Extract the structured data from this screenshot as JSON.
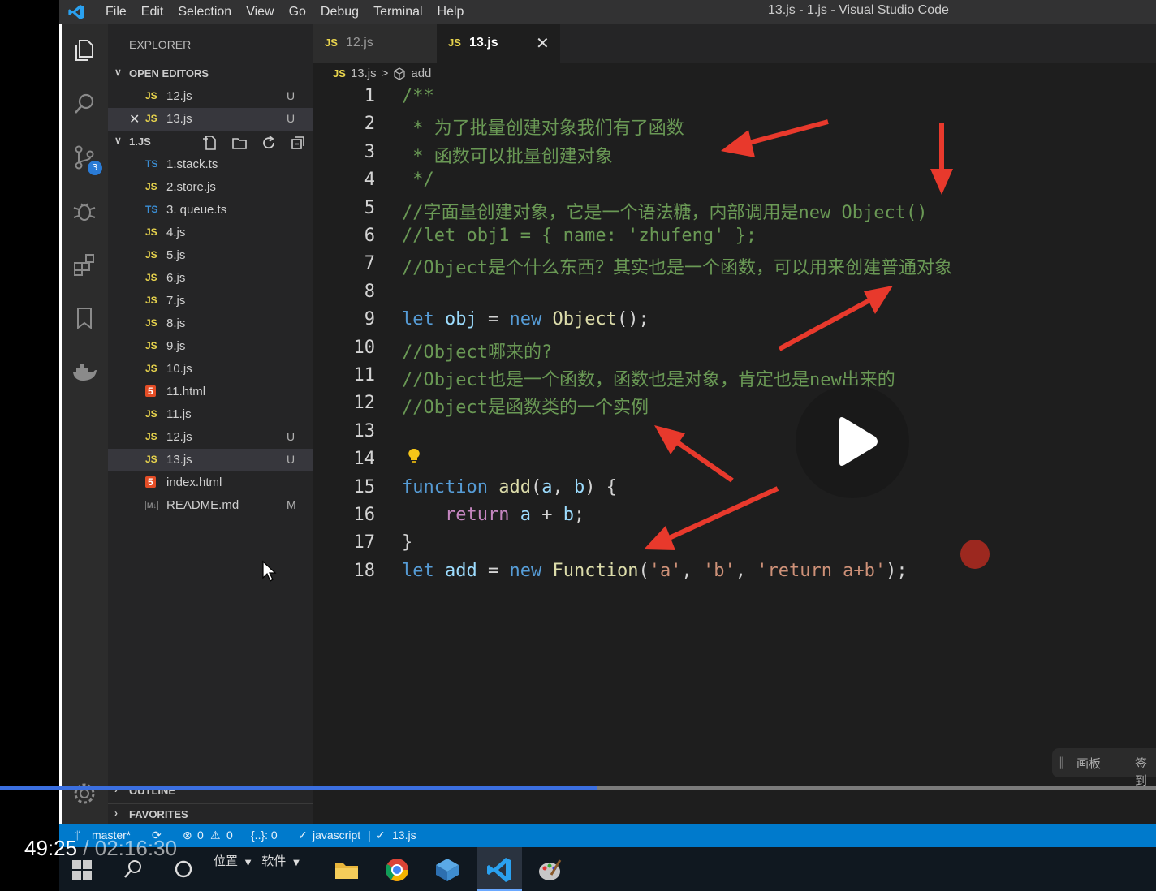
{
  "titlebar": {
    "menu": [
      "File",
      "Edit",
      "Selection",
      "View",
      "Go",
      "Debug",
      "Terminal",
      "Help"
    ],
    "window_title": "13.js - 1.js - Visual Studio Code"
  },
  "activity_bar": {
    "icons": [
      "files-icon",
      "search-icon",
      "source-control-icon",
      "debug-icon",
      "extensions-icon",
      "bookmark-icon",
      "docker-icon",
      "settings-gear-icon"
    ],
    "scm_badge": "3"
  },
  "sidebar": {
    "title": "EXPLORER",
    "open_editors": {
      "label": "OPEN EDITORS",
      "items": [
        {
          "icon": "JS",
          "name": "12.js",
          "status": "U"
        },
        {
          "icon": "JS",
          "name": "13.js",
          "status": "U"
        }
      ]
    },
    "folder": {
      "label": "1.JS",
      "files": [
        {
          "icon": "TS",
          "name": "1.stack.ts",
          "status": ""
        },
        {
          "icon": "JS",
          "name": "2.store.js",
          "status": ""
        },
        {
          "icon": "TS",
          "name": "3. queue.ts",
          "status": ""
        },
        {
          "icon": "JS",
          "name": "4.js",
          "status": ""
        },
        {
          "icon": "JS",
          "name": "5.js",
          "status": ""
        },
        {
          "icon": "JS",
          "name": "6.js",
          "status": ""
        },
        {
          "icon": "JS",
          "name": "7.js",
          "status": ""
        },
        {
          "icon": "JS",
          "name": "8.js",
          "status": ""
        },
        {
          "icon": "JS",
          "name": "9.js",
          "status": ""
        },
        {
          "icon": "JS",
          "name": "10.js",
          "status": ""
        },
        {
          "icon": "5",
          "name": "11.html",
          "status": ""
        },
        {
          "icon": "JS",
          "name": "11.js",
          "status": ""
        },
        {
          "icon": "JS",
          "name": "12.js",
          "status": "U"
        },
        {
          "icon": "JS",
          "name": "13.js",
          "status": "U"
        },
        {
          "icon": "5",
          "name": "index.html",
          "status": ""
        },
        {
          "icon": "M↓",
          "name": "README.md",
          "status": "M"
        }
      ]
    },
    "outline_label": "OUTLINE",
    "favorites_label": "FAVORITES"
  },
  "tabs": [
    {
      "icon": "JS",
      "name": "12.js"
    },
    {
      "icon": "JS",
      "name": "13.js",
      "close": "✕"
    }
  ],
  "breadcrumb": {
    "icon": "JS",
    "file": "13.js",
    "sep": ">",
    "symbol": "add"
  },
  "code_lines": [
    {
      "n": "1",
      "text": "/**"
    },
    {
      "n": "2",
      "text": " * 为了批量创建对象我们有了函数"
    },
    {
      "n": "3",
      "text": " * 函数可以批量创建对象"
    },
    {
      "n": "4",
      "text": " */"
    },
    {
      "n": "5",
      "text": "//字面量创建对象，它是一个语法糖，内部调用是new Object()"
    },
    {
      "n": "6",
      "text": "//let obj1 = { name: 'zhufeng' };"
    },
    {
      "n": "7",
      "text": "//Object是个什么东西？其实也是一个函数，可以用来创建普通对象"
    },
    {
      "n": "8",
      "text": ""
    },
    {
      "n": "9",
      "text": "let obj = new Object();"
    },
    {
      "n": "10",
      "text": "//Object哪来的?"
    },
    {
      "n": "11",
      "text": "//Object也是一个函数，函数也是对象，肯定也是new出来的"
    },
    {
      "n": "12",
      "text": "//Object是函数类的一个实例"
    },
    {
      "n": "13",
      "text": ""
    },
    {
      "n": "14",
      "text": ""
    },
    {
      "n": "15",
      "text": "function add(a, b) {"
    },
    {
      "n": "16",
      "text": "    return a + b;"
    },
    {
      "n": "17",
      "text": "}"
    },
    {
      "n": "18",
      "text": "let add = new Function('a', 'b', 'return a+b');"
    }
  ],
  "statusbar": {
    "branch": "master*",
    "errors": "0",
    "warnings": "0",
    "braces": "{..}: 0",
    "language": "javascript",
    "file_check": "13.js"
  },
  "side_panel": {
    "board": "画板",
    "sign": "签到"
  },
  "taskbar": {
    "text1": "位置",
    "text2": "软件"
  },
  "video": {
    "current": "49:25",
    "sep": " / ",
    "duration": "02:16:30",
    "progress": 0.516
  }
}
